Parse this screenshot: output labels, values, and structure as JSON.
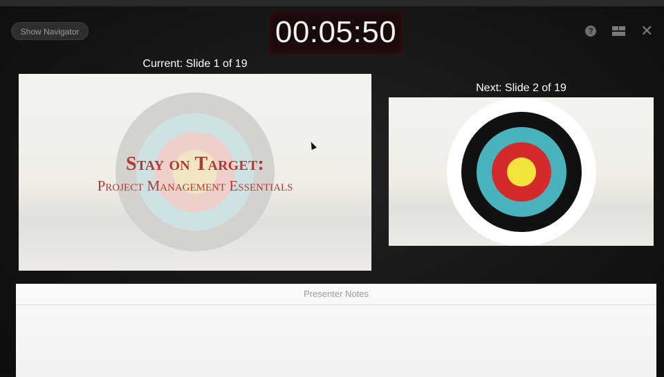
{
  "toolbar": {
    "show_navigator_label": "Show Navigator",
    "help_glyph": "?",
    "help_icon": "help-icon",
    "layout_icon": "layout-icon",
    "close_icon": "close-icon",
    "close_glyph": "✕"
  },
  "timer": {
    "value": "00:05:50"
  },
  "current": {
    "label": "Current: Slide 1 of 19",
    "title_line1": "Stay on Target:",
    "title_line2": "Project Management Essentials"
  },
  "next": {
    "label": "Next: Slide 2 of 19"
  },
  "notes": {
    "header": "Presenter Notes"
  },
  "colors": {
    "title_red": "#b23a33",
    "target_black": "#111111",
    "target_teal": "#48b3bd",
    "target_red": "#d42a2c",
    "target_yellow": "#f2e43b"
  }
}
